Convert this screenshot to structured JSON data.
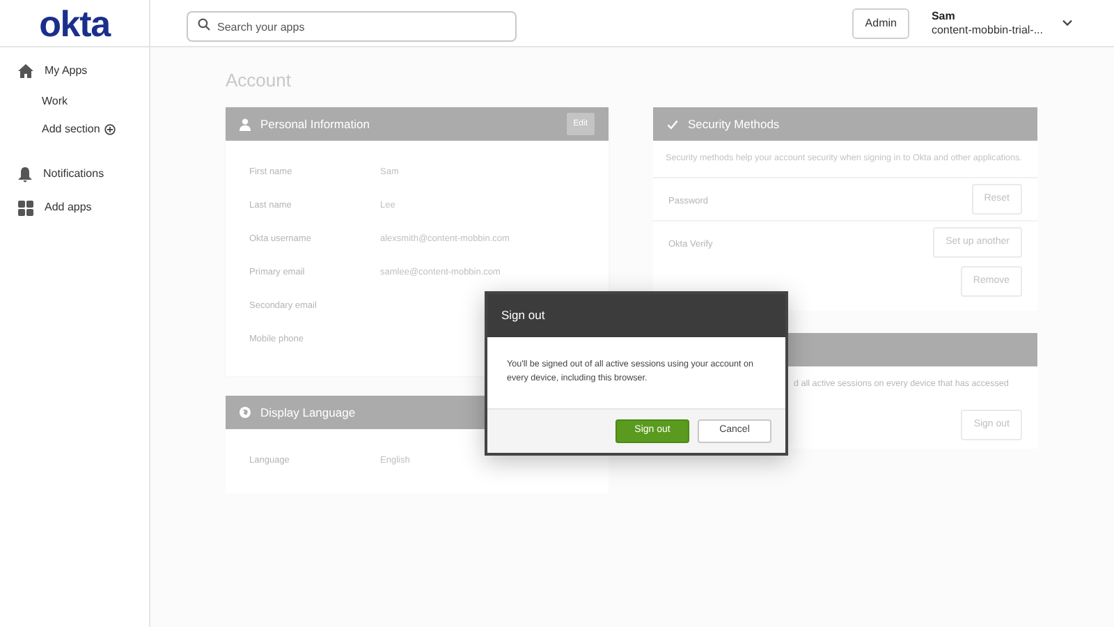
{
  "header": {
    "logo": "okta",
    "search": {
      "placeholder": "Search your apps"
    },
    "admin_button": "Admin",
    "user": {
      "name": "Sam",
      "org": "content-mobbin-trial-..."
    }
  },
  "sidebar": {
    "items": [
      {
        "label": "My Apps",
        "selected": false,
        "children": [
          {
            "label": "Work",
            "kind": "link"
          },
          {
            "label": "Add section",
            "kind": "add"
          }
        ]
      },
      {
        "label": "Notifications",
        "selected": false
      },
      {
        "label": "Add apps",
        "selected": false
      }
    ]
  },
  "page_title": "Account",
  "personal_information": {
    "title": "Personal Information",
    "edit_button": "Edit",
    "fields": [
      {
        "label": "First name",
        "value": "Sam"
      },
      {
        "label": "Last name",
        "value": "Lee"
      },
      {
        "label": "Okta username",
        "value": "alexsmith@content-mobbin.com"
      },
      {
        "label": "Primary email",
        "value": "samlee@content-mobbin.com"
      },
      {
        "label": "Secondary email"
      },
      {
        "label": "Mobile phone"
      }
    ]
  },
  "display_language": {
    "title": "Display Language",
    "fields": [
      {
        "label": "Language",
        "value": "English"
      }
    ]
  },
  "security_methods": {
    "title": "Security Methods",
    "description": "Security methods help your account security when signing in to Okta and other applications.",
    "methods": [
      {
        "label": "Password",
        "buttons": [
          "Reset"
        ]
      },
      {
        "label": "Okta Verify",
        "buttons": [
          "Set up another",
          "Remove"
        ]
      }
    ]
  },
  "sessions": {
    "description": "d all active sessions on every device that has accessed",
    "button": "Sign out"
  },
  "dialog": {
    "title": "Sign out",
    "message": "You'll be signed out of all active sessions using your account on every device, including this browser.",
    "confirm_button": "Sign out",
    "cancel_button": "Cancel"
  }
}
